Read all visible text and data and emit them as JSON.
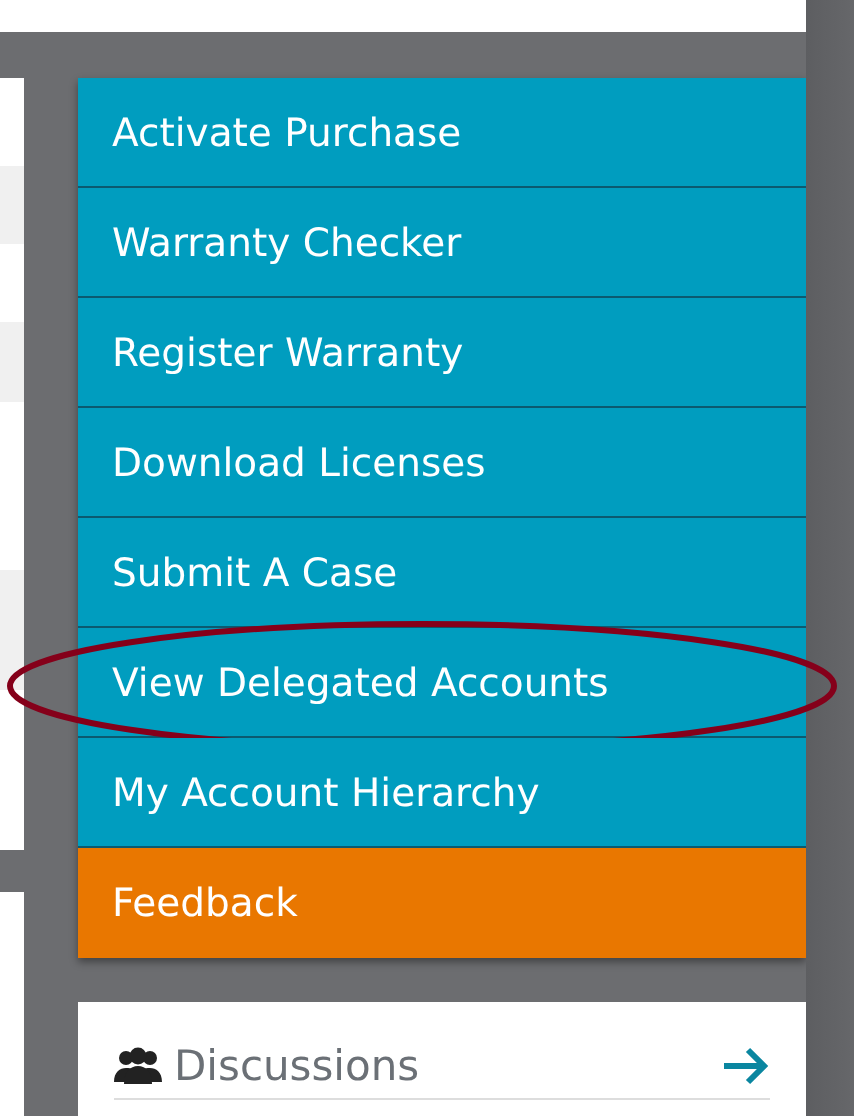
{
  "menu": {
    "items": [
      {
        "label": "Activate Purchase",
        "kind": "link",
        "highlighted": false
      },
      {
        "label": "Warranty Checker",
        "kind": "link",
        "highlighted": false
      },
      {
        "label": "Register Warranty",
        "kind": "link",
        "highlighted": false
      },
      {
        "label": "Download Licenses",
        "kind": "link",
        "highlighted": false
      },
      {
        "label": "Submit A Case",
        "kind": "link",
        "highlighted": false
      },
      {
        "label": "View Delegated Accounts",
        "kind": "link",
        "highlighted": true
      },
      {
        "label": "My Account Hierarchy",
        "kind": "link",
        "highlighted": false
      },
      {
        "label": "Feedback",
        "kind": "feedback",
        "highlighted": false
      }
    ]
  },
  "discussions": {
    "title": "Discussions"
  }
}
